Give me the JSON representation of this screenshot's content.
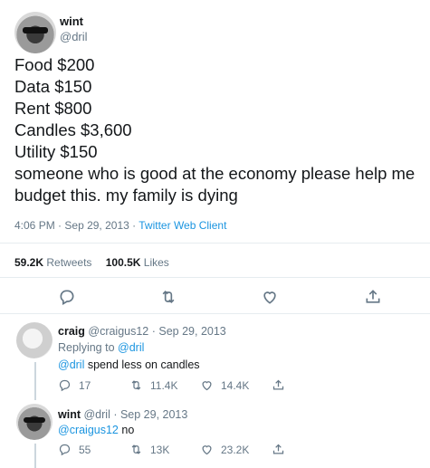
{
  "tweet": {
    "author_name": "wint",
    "author_handle": "@dril",
    "lines": [
      "Food $200",
      "Data $150",
      "Rent $800",
      "Candles $3,600",
      "Utility $150",
      "someone who is good at the economy please help me",
      "budget this. my family is dying"
    ],
    "time": "4:06 PM",
    "sep": "·",
    "date": "Sep 29, 2013",
    "client": "Twitter Web Client",
    "retweets_count": "59.2K",
    "retweets_label": "Retweets",
    "likes_count": "100.5K",
    "likes_label": "Likes"
  },
  "replies": [
    {
      "author_name": "craig",
      "author_handle": "@craigus12",
      "date": "· Sep 29, 2013",
      "replying_prefix": "Replying to",
      "replying_handle": "@dril",
      "mention": "@dril",
      "text": " spend less on candles",
      "replies": "17",
      "retweets": "11.4K",
      "likes": "14.4K"
    },
    {
      "author_name": "wint",
      "author_handle": "@dril",
      "date": "· Sep 29, 2013",
      "mention": "@craigus12",
      "text": " no",
      "replies": "55",
      "retweets": "13K",
      "likes": "23.2K"
    }
  ]
}
